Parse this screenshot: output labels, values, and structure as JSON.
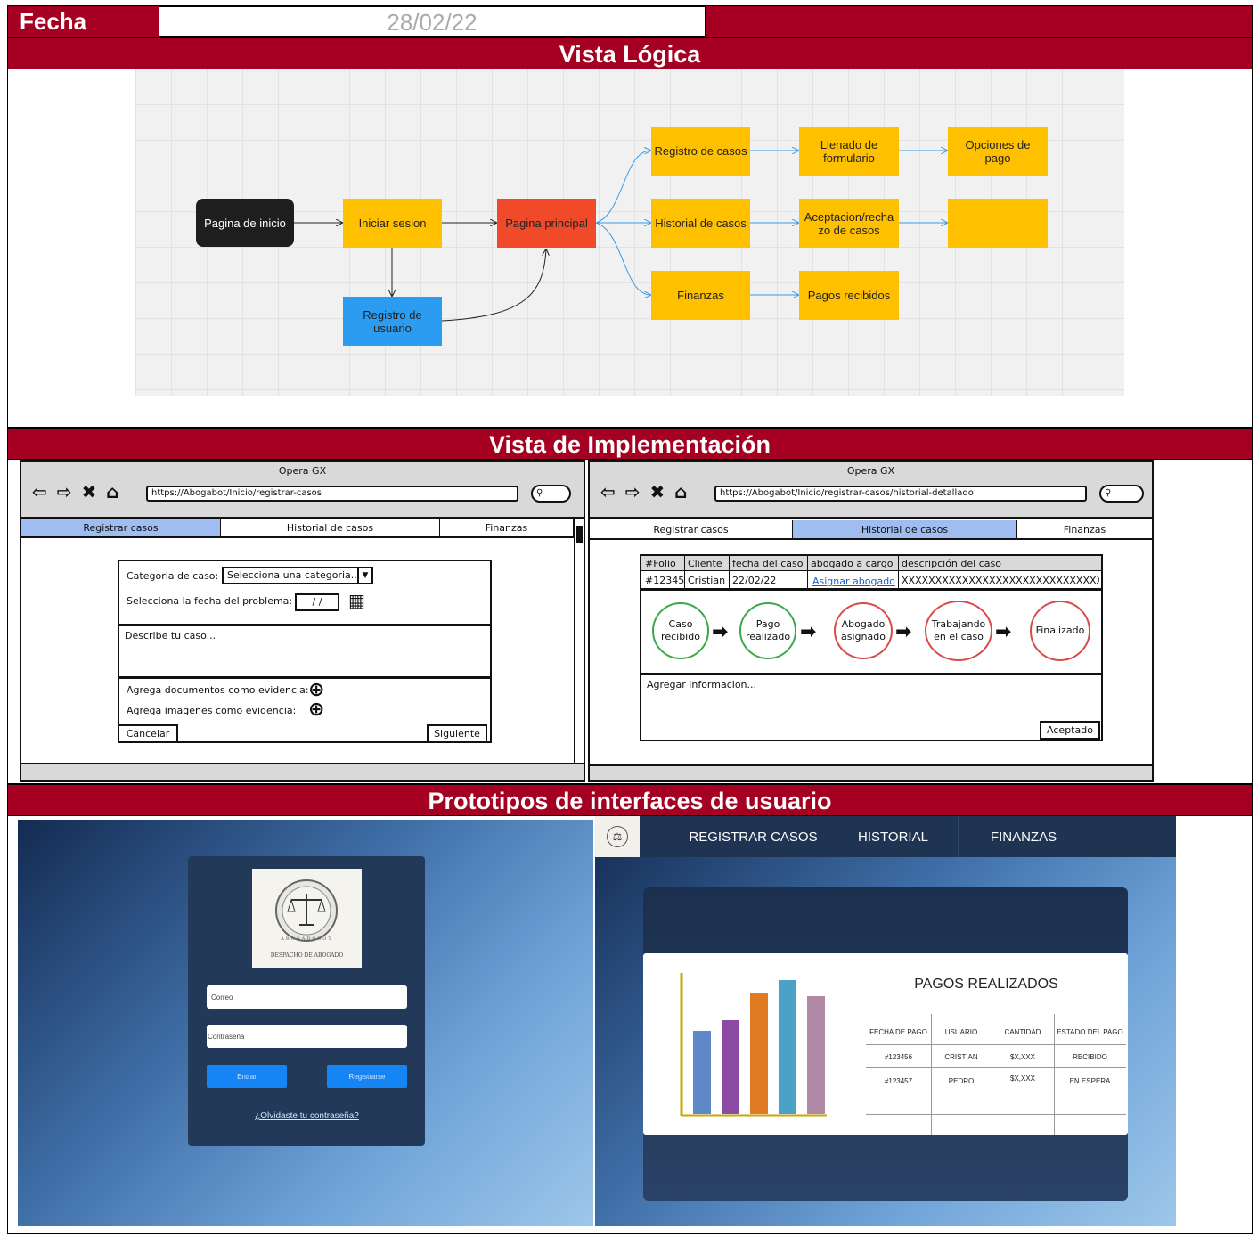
{
  "fecha": {
    "label": "Fecha",
    "value": "28/02/22"
  },
  "sections": {
    "logica": "Vista Lógica",
    "implementacion": "Vista de Implementación",
    "prototipos": "Prototipos de interfaces de usuario"
  },
  "diagram": {
    "nodes": {
      "inicio": "Pagina de inicio",
      "sesion": "Iniciar sesion",
      "registro_usuario": "Registro de usuario",
      "principal": "Pagina principal",
      "registro_casos": "Registro de casos",
      "historial": "Historial de casos",
      "finanzas": "Finanzas",
      "llenado": "Llenado de formulario",
      "aceptacion": "Aceptacion/rechazo de casos",
      "pagos_recibidos": "Pagos recibidos",
      "opciones_pago": "Opciones de pago",
      "vacio": ""
    },
    "colors": {
      "dark": "#1e1e1e",
      "yellow": "#ffc000",
      "red": "#f04a2a",
      "blue": "#2b9cf0",
      "arrow_blue": "#3a9ae8"
    }
  },
  "wireframe_left": {
    "browser": "Opera GX",
    "url": "https://Abogabot/Inicio/registrar-casos",
    "tabs": [
      "Registrar casos",
      "Historial de casos",
      "Finanzas"
    ],
    "categoria_label": "Categoria de caso:",
    "categoria_value": "Selecciona una categoria...",
    "fecha_label": "Selecciona la fecha del problema:",
    "fecha_value": "/ /",
    "describe_placeholder": "Describe tu caso...",
    "docs_label": "Agrega documentos como evidencia:",
    "imgs_label": "Agrega imagenes como evidencia:",
    "cancel": "Cancelar",
    "next": "Siguiente"
  },
  "wireframe_right": {
    "browser": "Opera GX",
    "url": "https://Abogabot/Inicio/registrar-casos/historial-detallado",
    "tabs": [
      "Registrar casos",
      "Historial de casos",
      "Finanzas"
    ],
    "table_headers": [
      "#Folio",
      "Cliente",
      "fecha del caso",
      "abogado a cargo",
      "descripción del caso"
    ],
    "table_row": [
      "#12345",
      "Cristian",
      "22/02/22",
      "Asignar abogado",
      "XXXXXXXXXXXXXXXXXXXXXXXXXXXXXXX"
    ],
    "steps": [
      "Caso recibido",
      "Pago realizado",
      "Abogado asignado",
      "Trabajando en el caso",
      "Finalizado"
    ],
    "info_placeholder": "Agregar informacion...",
    "accept": "Aceptado"
  },
  "login": {
    "logo_text": "ABOGADOBOT",
    "logo_caption": "DESPACHO DE ABOGADO",
    "email_placeholder": "Correo",
    "password_placeholder": "Contraseña",
    "enter": "Entrar",
    "register": "Registrarse",
    "forgot": "¿Olvidaste tu contraseña?"
  },
  "finanzas": {
    "nav": [
      "REGISTRAR CASOS",
      "HISTORIAL",
      "FINANZAS"
    ],
    "title": "PAGOS REALIZADOS",
    "headers": [
      "FECHA DE PAGO",
      "USUARIO",
      "CANTIDAD",
      "ESTADO DEL PAGO"
    ],
    "rows": [
      [
        "#123456",
        "CRISTIAN",
        "$X,XXX",
        "RECIBIDO"
      ],
      [
        "#123457",
        "PEDRO",
        "$X,XXX",
        "EN ESPERA"
      ]
    ],
    "bar_colors": [
      "#5f88c9",
      "#8c4aa5",
      "#e07a23",
      "#4aa3c7",
      "#b08aa5"
    ],
    "bar_values": [
      0.62,
      0.7,
      0.9,
      1.0,
      0.88
    ]
  }
}
